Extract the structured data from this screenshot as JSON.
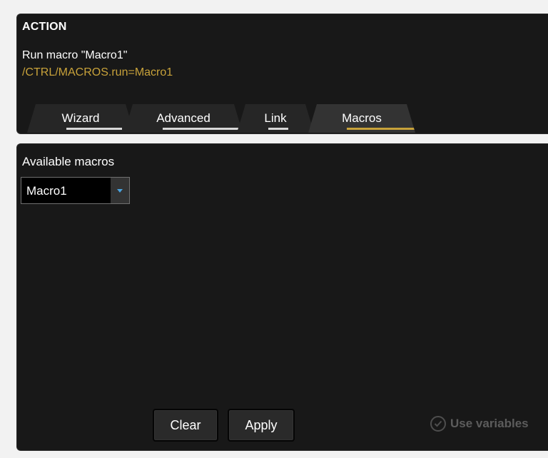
{
  "action": {
    "title": "ACTION",
    "description": "Run macro \"Macro1\"",
    "command": "/CTRL/MACROS.run=Macro1"
  },
  "tabs": [
    {
      "label": "Wizard",
      "active": false
    },
    {
      "label": "Advanced",
      "active": false
    },
    {
      "label": "Link",
      "active": false
    },
    {
      "label": "Macros",
      "active": true
    }
  ],
  "macros": {
    "label": "Available macros",
    "selected": "Macro1"
  },
  "buttons": {
    "clear": "Clear",
    "apply": "Apply"
  },
  "use_variables": {
    "label": "Use variables",
    "checked": false
  },
  "colors": {
    "accent": "#c8a23a",
    "panel": "#181818",
    "background": "#f2f2f2",
    "select_arrow": "#4aa3df"
  },
  "icons": {
    "dropdown": "chevron-down-icon",
    "use_variables": "check-circle-icon"
  }
}
